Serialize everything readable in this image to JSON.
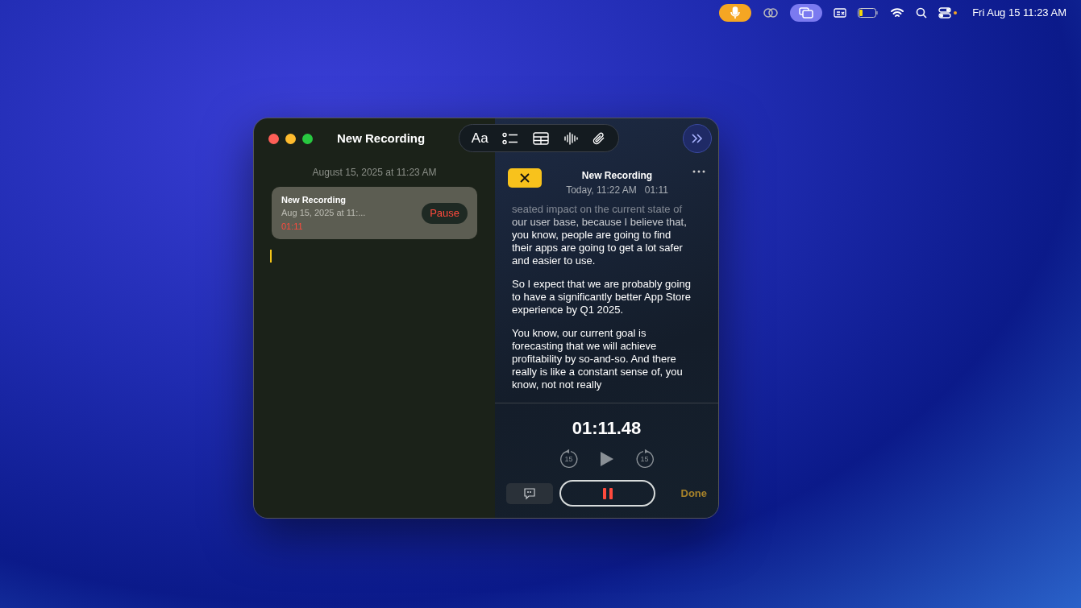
{
  "menu_bar": {
    "clock": "Fri Aug 15 11:23 AM",
    "mic_active": true
  },
  "window": {
    "title": "New Recording"
  },
  "toolbar": {
    "format_label": "Aa"
  },
  "note": {
    "date_header": "August 15, 2025 at 11:23 AM",
    "recording_card": {
      "title": "New Recording",
      "subtitle": "Aug 15, 2025 at 11:...",
      "duration": "01:11",
      "button": "Pause"
    }
  },
  "panel": {
    "title": "New Recording",
    "meta": "Today, 11:22 AM   01:11",
    "transcript": [
      "seated impact on the current state of our user base, because I believe that, you know, people are going to find their apps are going to get a lot safer and easier to use.",
      "So I expect that we are probably going to have a significantly better App Store experience by Q1 2025.",
      "You know, our current goal is forecasting that we will achieve profitability by so-and-so. And there really is like a constant sense of, you know, not not really"
    ],
    "timer": "01:11.48",
    "skip_back": "15",
    "skip_forward": "15",
    "recording": true,
    "done": "Done"
  }
}
